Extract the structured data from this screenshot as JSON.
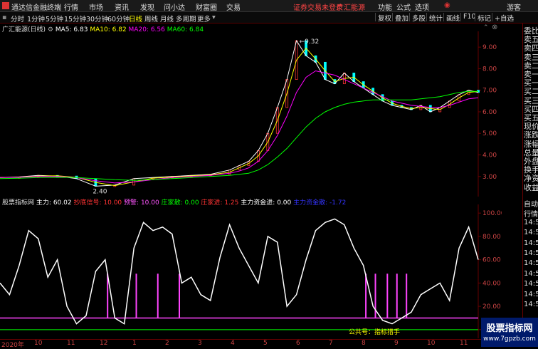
{
  "menubar": {
    "app_title": "通达信金融终端",
    "menus": [
      "行情",
      "市场",
      "资讯",
      "发现",
      "问小达",
      "财富圈",
      "交易"
    ],
    "login_notice": "证券交易未登录",
    "broker": "广汇能源",
    "right_menus": [
      "功能",
      "公式",
      "选项",
      "游客"
    ]
  },
  "toolbar": {
    "periods": [
      "分时",
      "1分钟",
      "5分钟",
      "15分钟",
      "30分钟",
      "60分钟",
      "日线",
      "周线",
      "月线",
      "多周期",
      "更多"
    ],
    "active_period": "日线",
    "right_buttons": [
      "复权",
      "叠加",
      "多股",
      "统计",
      "画线",
      "F10",
      "标记",
      "+自选"
    ]
  },
  "chart_data": [
    {
      "type": "line",
      "title": "广汇能源(日线)",
      "legend": [
        {
          "name": "MA5",
          "value": "6.83",
          "color": "#ffffff"
        },
        {
          "name": "MA10",
          "value": "6.82",
          "color": "#ffff00"
        },
        {
          "name": "MA20",
          "value": "6.56",
          "color": "#ff00ff"
        },
        {
          "name": "MA60",
          "value": "6.84",
          "color": "#00ff00"
        }
      ],
      "y_ticks": [
        "9.00",
        "8.00",
        "7.00",
        "6.00",
        "5.00",
        "4.00",
        "3.00"
      ],
      "ylim": [
        2.2,
        9.6
      ],
      "annotations": [
        {
          "text": "9.32"
        },
        {
          "text": "2.40"
        }
      ],
      "x": [
        0,
        8,
        16,
        24,
        32,
        40,
        48,
        56,
        64,
        72,
        80,
        88,
        96,
        100,
        104,
        108,
        112,
        116,
        120,
        124,
        128,
        132,
        136,
        140,
        144,
        148,
        152,
        156,
        160,
        164,
        168,
        172,
        176,
        180,
        184,
        188,
        192,
        196,
        200
      ],
      "price": [
        2.95,
        2.98,
        3.05,
        3.02,
        2.9,
        2.55,
        2.6,
        2.9,
        2.95,
        3.0,
        3.05,
        3.1,
        3.3,
        3.5,
        3.7,
        4.2,
        5.0,
        6.2,
        7.5,
        9.3,
        8.6,
        8.3,
        7.5,
        7.3,
        7.8,
        7.4,
        7.1,
        6.8,
        6.5,
        6.3,
        6.2,
        6.1,
        6.3,
        6.0,
        6.2,
        6.5,
        6.8,
        7.0,
        6.9
      ],
      "ma20": [
        2.95,
        2.96,
        3.0,
        3.0,
        2.95,
        2.8,
        2.7,
        2.75,
        2.85,
        2.95,
        3.0,
        3.05,
        3.15,
        3.25,
        3.4,
        3.7,
        4.2,
        4.9,
        5.8,
        6.9,
        7.6,
        7.9,
        7.8,
        7.7,
        7.5,
        7.3,
        7.1,
        6.9,
        6.7,
        6.5,
        6.4,
        6.3,
        6.25,
        6.2,
        6.2,
        6.3,
        6.45,
        6.6,
        6.65
      ],
      "ma60": [
        2.9,
        2.92,
        2.95,
        2.96,
        2.95,
        2.9,
        2.85,
        2.82,
        2.85,
        2.9,
        2.95,
        3.0,
        3.05,
        3.1,
        3.15,
        3.3,
        3.55,
        3.9,
        4.3,
        4.8,
        5.3,
        5.7,
        6.0,
        6.2,
        6.35,
        6.45,
        6.5,
        6.55,
        6.55,
        6.55,
        6.55,
        6.55,
        6.6,
        6.65,
        6.7,
        6.8,
        6.9,
        6.95,
        6.95
      ]
    },
    {
      "type": "line",
      "title": "股票指标网",
      "legend": [
        {
          "name": "主力",
          "value": "60.02",
          "color": "#ffffff"
        },
        {
          "name": "抄底信号",
          "value": "10.00",
          "color": "#ff3333"
        },
        {
          "name": "预警",
          "value": "10.00",
          "color": "#ff55ff"
        },
        {
          "name": "庄家散",
          "value": "0.00",
          "color": "#00ff00"
        },
        {
          "name": "庄家进",
          "value": "1.25",
          "color": "#ff3333"
        },
        {
          "name": "主力资金进",
          "value": "0.00",
          "color": "#ffffff"
        },
        {
          "name": "主力资金散",
          "value": "-1.72",
          "color": "#3333ff"
        }
      ],
      "y_ticks": [
        "100.00",
        "80.00",
        "60.00",
        "40.00",
        "20.00",
        "0.00"
      ],
      "ylim": [
        -5,
        105
      ],
      "x": [
        0,
        4,
        8,
        12,
        16,
        20,
        24,
        28,
        32,
        36,
        40,
        44,
        48,
        52,
        56,
        60,
        64,
        68,
        72,
        76,
        80,
        84,
        88,
        92,
        96,
        100,
        104,
        108,
        112,
        116,
        120,
        124,
        128,
        132,
        136,
        140,
        144,
        148,
        152,
        156,
        160,
        164,
        168,
        172,
        176,
        180,
        184,
        188,
        192,
        196,
        200
      ],
      "zhuli": [
        40,
        30,
        55,
        85,
        78,
        45,
        60,
        20,
        5,
        12,
        50,
        60,
        10,
        5,
        70,
        92,
        85,
        88,
        82,
        40,
        45,
        30,
        25,
        62,
        90,
        70,
        55,
        40,
        80,
        75,
        20,
        30,
        60,
        85,
        92,
        95,
        90,
        70,
        55,
        20,
        8,
        5,
        10,
        15,
        30,
        35,
        40,
        25,
        70,
        88,
        60
      ],
      "signals": [
        45,
        57,
        66,
        75,
        153,
        157,
        162,
        166,
        170
      ],
      "baseline": 10,
      "watermark": "公共号：指标猎手"
    }
  ],
  "x_axis": [
    "2020年",
    "10",
    "11",
    "12",
    "1",
    "2",
    "3",
    "4",
    "5",
    "6",
    "7",
    "8",
    "9",
    "10",
    "11"
  ],
  "sidebar": {
    "items": [
      "委比",
      "卖五",
      "卖四",
      "卖三",
      "卖二",
      "卖一",
      "买一",
      "买二",
      "买三",
      "买四",
      "买五",
      "现价",
      "涨跌",
      "涨幅",
      "总量",
      "外盘",
      "换手",
      "净资",
      "收益"
    ],
    "items2": [
      "自动",
      "行情",
      "14:50",
      "14:50",
      "14:50",
      "14:50",
      "14:50",
      "14:50",
      "14:50",
      "14:50",
      "14:50"
    ]
  },
  "site_logo": {
    "name": "股票指标网",
    "url": "www.7gpzb.com"
  }
}
